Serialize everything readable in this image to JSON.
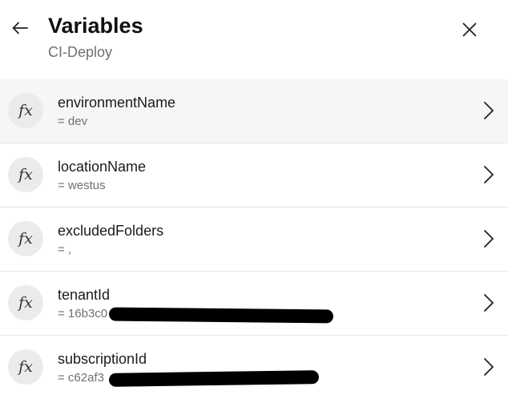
{
  "header": {
    "title": "Variables",
    "subtitle": "CI-Deploy",
    "back_icon": "arrow-left-icon",
    "close_icon": "close-icon"
  },
  "variables": [
    {
      "icon_text": "fx",
      "name": "environmentName",
      "value": "= dev",
      "selected": true
    },
    {
      "icon_text": "fx",
      "name": "locationName",
      "value": "= westus",
      "selected": false
    },
    {
      "icon_text": "fx",
      "name": "excludedFolders",
      "value": "= ,",
      "selected": false
    },
    {
      "icon_text": "fx",
      "name": "tenantId",
      "value": "= 16b3c0",
      "redacted": true,
      "selected": false
    },
    {
      "icon_text": "fx",
      "name": "subscriptionId",
      "value": "= c62af3",
      "redacted": true,
      "selected": false
    }
  ],
  "colors": {
    "selected_row_bg": "#f6f6f6",
    "icon_circle_bg": "#ebebeb",
    "secondary_text": "#707070",
    "redaction": "#000000"
  }
}
